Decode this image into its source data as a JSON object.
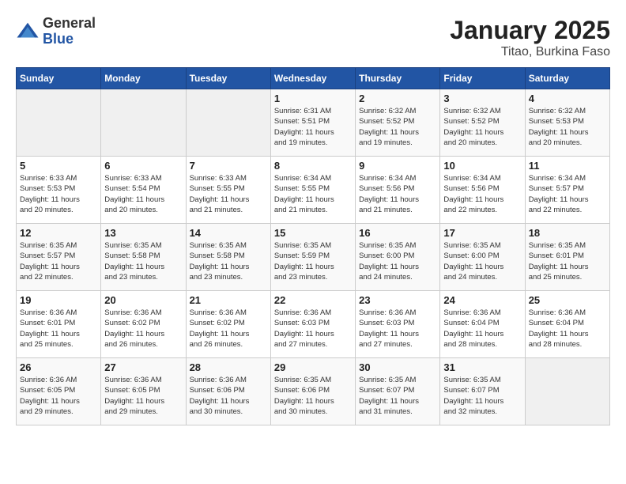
{
  "header": {
    "logo_general": "General",
    "logo_blue": "Blue",
    "month_title": "January 2025",
    "location": "Titao, Burkina Faso"
  },
  "weekdays": [
    "Sunday",
    "Monday",
    "Tuesday",
    "Wednesday",
    "Thursday",
    "Friday",
    "Saturday"
  ],
  "weeks": [
    [
      {
        "day": "",
        "info": ""
      },
      {
        "day": "",
        "info": ""
      },
      {
        "day": "",
        "info": ""
      },
      {
        "day": "1",
        "info": "Sunrise: 6:31 AM\nSunset: 5:51 PM\nDaylight: 11 hours\nand 19 minutes."
      },
      {
        "day": "2",
        "info": "Sunrise: 6:32 AM\nSunset: 5:52 PM\nDaylight: 11 hours\nand 19 minutes."
      },
      {
        "day": "3",
        "info": "Sunrise: 6:32 AM\nSunset: 5:52 PM\nDaylight: 11 hours\nand 20 minutes."
      },
      {
        "day": "4",
        "info": "Sunrise: 6:32 AM\nSunset: 5:53 PM\nDaylight: 11 hours\nand 20 minutes."
      }
    ],
    [
      {
        "day": "5",
        "info": "Sunrise: 6:33 AM\nSunset: 5:53 PM\nDaylight: 11 hours\nand 20 minutes."
      },
      {
        "day": "6",
        "info": "Sunrise: 6:33 AM\nSunset: 5:54 PM\nDaylight: 11 hours\nand 20 minutes."
      },
      {
        "day": "7",
        "info": "Sunrise: 6:33 AM\nSunset: 5:55 PM\nDaylight: 11 hours\nand 21 minutes."
      },
      {
        "day": "8",
        "info": "Sunrise: 6:34 AM\nSunset: 5:55 PM\nDaylight: 11 hours\nand 21 minutes."
      },
      {
        "day": "9",
        "info": "Sunrise: 6:34 AM\nSunset: 5:56 PM\nDaylight: 11 hours\nand 21 minutes."
      },
      {
        "day": "10",
        "info": "Sunrise: 6:34 AM\nSunset: 5:56 PM\nDaylight: 11 hours\nand 22 minutes."
      },
      {
        "day": "11",
        "info": "Sunrise: 6:34 AM\nSunset: 5:57 PM\nDaylight: 11 hours\nand 22 minutes."
      }
    ],
    [
      {
        "day": "12",
        "info": "Sunrise: 6:35 AM\nSunset: 5:57 PM\nDaylight: 11 hours\nand 22 minutes."
      },
      {
        "day": "13",
        "info": "Sunrise: 6:35 AM\nSunset: 5:58 PM\nDaylight: 11 hours\nand 23 minutes."
      },
      {
        "day": "14",
        "info": "Sunrise: 6:35 AM\nSunset: 5:58 PM\nDaylight: 11 hours\nand 23 minutes."
      },
      {
        "day": "15",
        "info": "Sunrise: 6:35 AM\nSunset: 5:59 PM\nDaylight: 11 hours\nand 23 minutes."
      },
      {
        "day": "16",
        "info": "Sunrise: 6:35 AM\nSunset: 6:00 PM\nDaylight: 11 hours\nand 24 minutes."
      },
      {
        "day": "17",
        "info": "Sunrise: 6:35 AM\nSunset: 6:00 PM\nDaylight: 11 hours\nand 24 minutes."
      },
      {
        "day": "18",
        "info": "Sunrise: 6:35 AM\nSunset: 6:01 PM\nDaylight: 11 hours\nand 25 minutes."
      }
    ],
    [
      {
        "day": "19",
        "info": "Sunrise: 6:36 AM\nSunset: 6:01 PM\nDaylight: 11 hours\nand 25 minutes."
      },
      {
        "day": "20",
        "info": "Sunrise: 6:36 AM\nSunset: 6:02 PM\nDaylight: 11 hours\nand 26 minutes."
      },
      {
        "day": "21",
        "info": "Sunrise: 6:36 AM\nSunset: 6:02 PM\nDaylight: 11 hours\nand 26 minutes."
      },
      {
        "day": "22",
        "info": "Sunrise: 6:36 AM\nSunset: 6:03 PM\nDaylight: 11 hours\nand 27 minutes."
      },
      {
        "day": "23",
        "info": "Sunrise: 6:36 AM\nSunset: 6:03 PM\nDaylight: 11 hours\nand 27 minutes."
      },
      {
        "day": "24",
        "info": "Sunrise: 6:36 AM\nSunset: 6:04 PM\nDaylight: 11 hours\nand 28 minutes."
      },
      {
        "day": "25",
        "info": "Sunrise: 6:36 AM\nSunset: 6:04 PM\nDaylight: 11 hours\nand 28 minutes."
      }
    ],
    [
      {
        "day": "26",
        "info": "Sunrise: 6:36 AM\nSunset: 6:05 PM\nDaylight: 11 hours\nand 29 minutes."
      },
      {
        "day": "27",
        "info": "Sunrise: 6:36 AM\nSunset: 6:05 PM\nDaylight: 11 hours\nand 29 minutes."
      },
      {
        "day": "28",
        "info": "Sunrise: 6:36 AM\nSunset: 6:06 PM\nDaylight: 11 hours\nand 30 minutes."
      },
      {
        "day": "29",
        "info": "Sunrise: 6:35 AM\nSunset: 6:06 PM\nDaylight: 11 hours\nand 30 minutes."
      },
      {
        "day": "30",
        "info": "Sunrise: 6:35 AM\nSunset: 6:07 PM\nDaylight: 11 hours\nand 31 minutes."
      },
      {
        "day": "31",
        "info": "Sunrise: 6:35 AM\nSunset: 6:07 PM\nDaylight: 11 hours\nand 32 minutes."
      },
      {
        "day": "",
        "info": ""
      }
    ]
  ]
}
